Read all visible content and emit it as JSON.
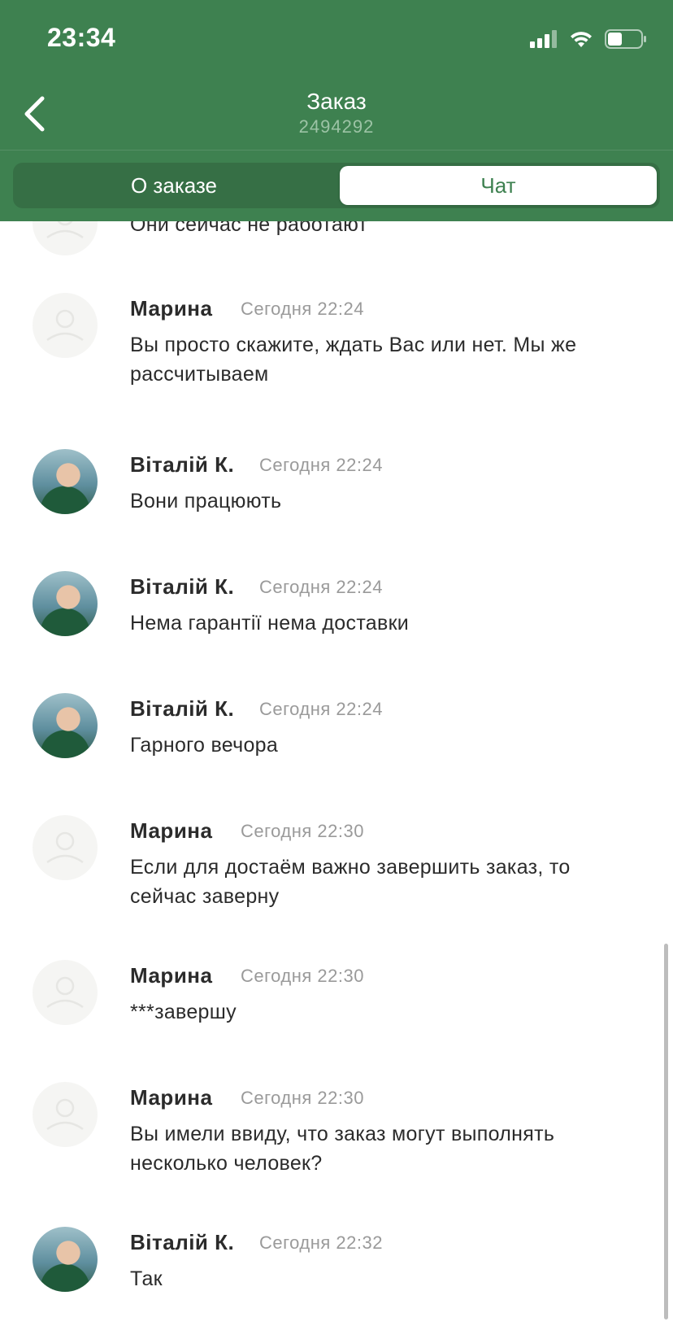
{
  "status_bar": {
    "time": "23:34"
  },
  "header": {
    "back_icon": "chevron-left-icon",
    "title": "Заказ",
    "order_number": "2494292"
  },
  "tabs": [
    {
      "label": "О заказе",
      "active": false
    },
    {
      "label": "Чат",
      "active": true
    }
  ],
  "colors": {
    "header_green": "#3e8150",
    "tab_track": "#366f45",
    "active_tab_text": "#3e8150"
  },
  "messages": [
    {
      "sender": "",
      "time": "",
      "text": "Они сейчас не работают",
      "avatar": "default-avatar-icon"
    },
    {
      "sender": "Марина",
      "time": "Сегодня 22:24",
      "text": "Вы просто скажите, ждать Вас или нет. Мы же рассчитываем",
      "avatar": "default-avatar-icon"
    },
    {
      "sender": "Віталій К.",
      "time": "Сегодня 22:24",
      "text": "Вони працюють",
      "avatar": "user-photo"
    },
    {
      "sender": "Віталій К.",
      "time": "Сегодня 22:24",
      "text": "Нема гарантії нема доставки",
      "avatar": "user-photo"
    },
    {
      "sender": "Віталій К.",
      "time": "Сегодня 22:24",
      "text": "Гарного вечора",
      "avatar": "user-photo"
    },
    {
      "sender": "Марина",
      "time": "Сегодня 22:30",
      "text": "Если для достаём важно завершить заказ, то сейчас заверну",
      "avatar": "default-avatar-icon"
    },
    {
      "sender": "Марина",
      "time": "Сегодня 22:30",
      "text": "***завершу",
      "avatar": "default-avatar-icon"
    },
    {
      "sender": "Марина",
      "time": "Сегодня 22:30",
      "text": "Вы имели ввиду, что заказ могут выполнять несколько человек?",
      "avatar": "default-avatar-icon"
    },
    {
      "sender": "Віталій К.",
      "time": "Сегодня 22:32",
      "text": "Так",
      "avatar": "user-photo"
    }
  ]
}
